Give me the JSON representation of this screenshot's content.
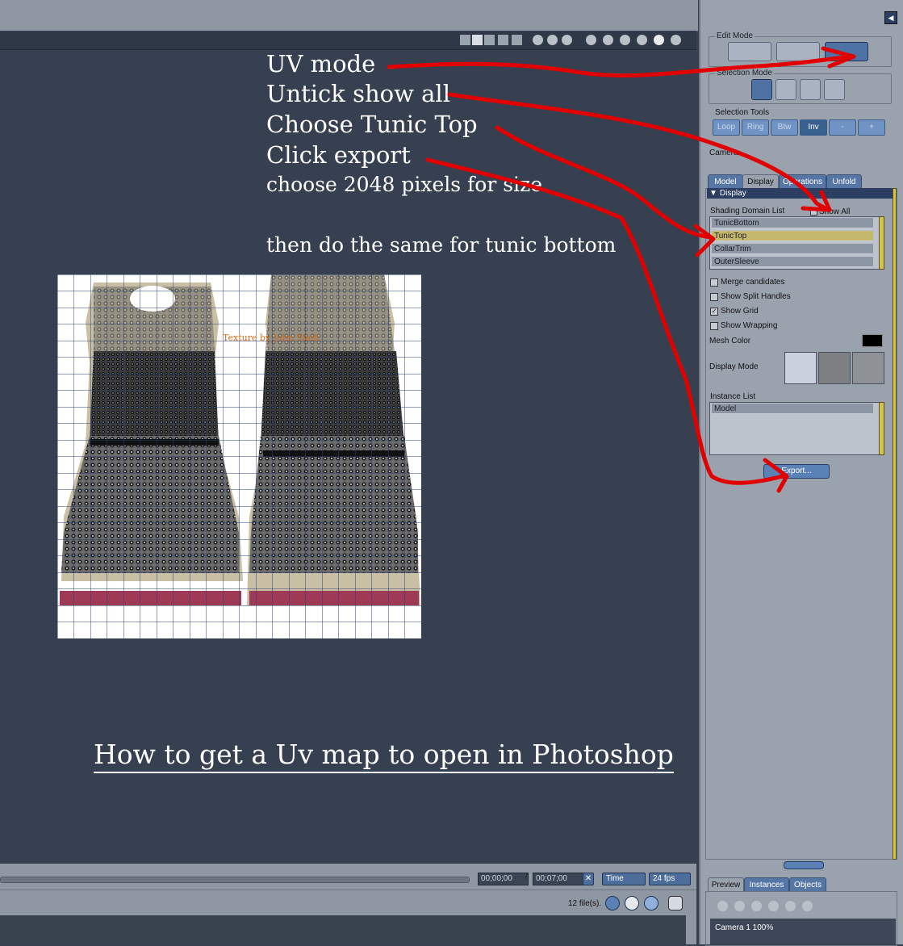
{
  "annotations": {
    "lines": [
      "UV mode",
      "Untick show all",
      "Choose Tunic Top",
      "Click export",
      "choose 2048 pixels for size",
      "then do the same for tunic bottom"
    ],
    "title": "How to get a Uv map to open in Photoshop",
    "watermark": "Texture by John Madi"
  },
  "timeline": {
    "current_time": "00;00;00",
    "separator": "/",
    "end_time": "00;07;00",
    "time_mode": "Time",
    "fps": "24 fps",
    "file_count": "12 file(s)."
  },
  "panel": {
    "edit_mode_label": "Edit Mode",
    "selection_mode_label": "Selection Mode",
    "selection_tools_label": "Selection Tools",
    "selection_tools": [
      "Loop",
      "Ring",
      "Btw",
      "Inv",
      "-",
      "+"
    ],
    "camera_label": "Camera",
    "tabs": [
      "Model",
      "Display",
      "Operations",
      "Unfold"
    ],
    "display_header": "Display",
    "shading_domain_label": "Shading Domain List",
    "show_all_label": "Show All",
    "shading_domains": [
      "TunicBottom",
      "TunicTop",
      "CollarTrim",
      "OuterSleeve"
    ],
    "options": {
      "merge": "Merge candidates",
      "split": "Show Split Handles",
      "grid": "Show Grid",
      "wrapping": "Show Wrapping"
    },
    "mesh_color_label": "Mesh Color",
    "mesh_color": "#000000",
    "display_mode_label": "Display Mode",
    "instance_list_label": "Instance List",
    "instances": [
      "Model"
    ],
    "export_button": "Export...",
    "bottom_tabs": [
      "Preview",
      "Instances",
      "Objects"
    ],
    "preview_caption": "Camera 1 100%"
  },
  "colors": {
    "annotation_arrow": "#e00000",
    "viewport_bg": "#364050",
    "accent_blue": "#4d72a3"
  }
}
